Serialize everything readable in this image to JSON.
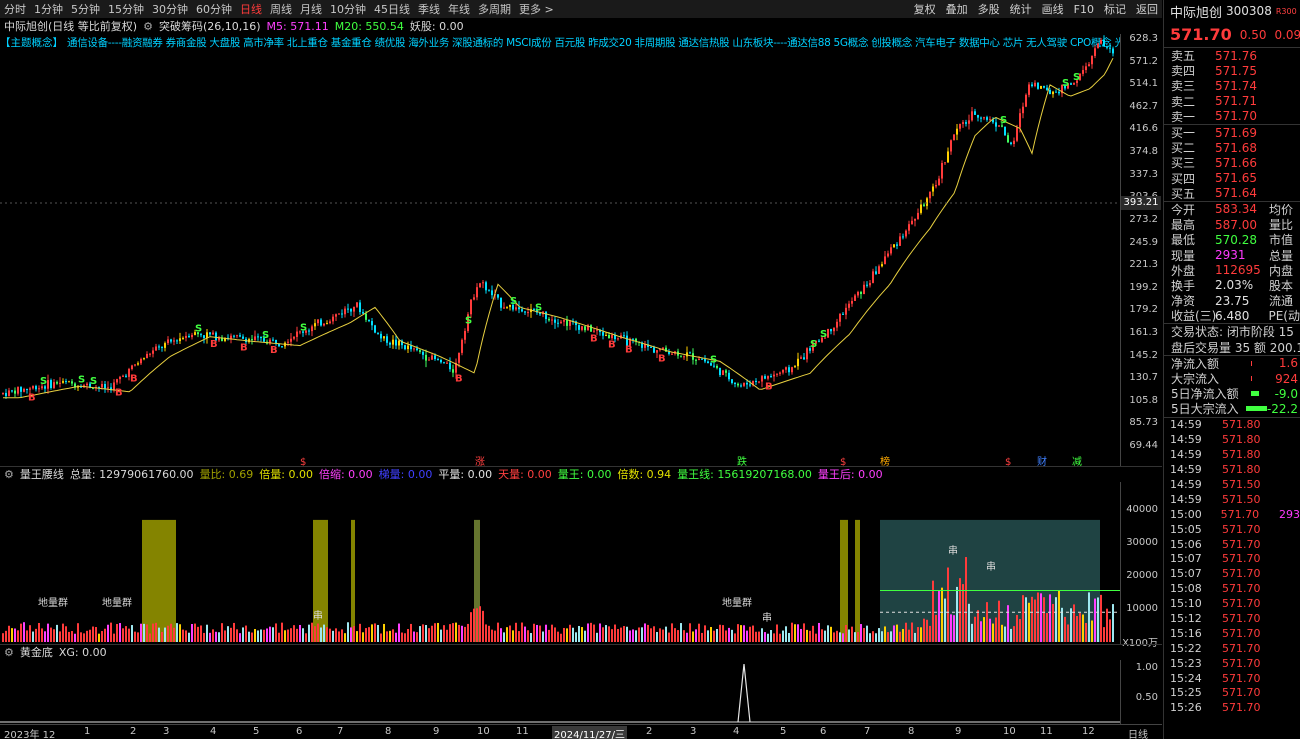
{
  "toolbar": {
    "periods": [
      "分时",
      "1分钟",
      "5分钟",
      "15分钟",
      "30分钟",
      "60分钟",
      "日线",
      "周线",
      "月线",
      "10分钟",
      "45日线",
      "季线",
      "年线",
      "多周期",
      "更多 >"
    ],
    "active_period": "日线",
    "tools": [
      "复权",
      "叠加",
      "多股",
      "统计",
      "画线",
      "F10",
      "标记",
      "返回"
    ]
  },
  "info": {
    "stock_label": "中际旭创(日线 等比前复权)",
    "indicator": "突破筹码(26,10,16)",
    "ma5": "M5: 571.11",
    "ma20": "M20: 550.54",
    "yao": "妖股: 0.00"
  },
  "concepts": {
    "label": "【主题概念】",
    "items": "通信设备----融资融券 券商金股 大盘股 高市净率 北上重仓 基金重仓 绩优股 海外业务 深股通标的 MSCI成份 百元股 昨成交20 非周期股 通达信热股 山东板块----通达信88 5G概念 创投概念 汽车电子 数据中心 芯片 无人驾驶 CPO概念 光"
  },
  "main_axis": [
    "628.3",
    "571.2",
    "514.1",
    "462.7",
    "416.6",
    "374.8",
    "337.3",
    "303.6",
    "273.2",
    "245.9",
    "221.3",
    "199.2",
    "179.2",
    "161.3",
    "145.2",
    "130.7",
    "105.8",
    "85.73",
    "69.44"
  ],
  "current_price_box": "393.21",
  "markers": [
    {
      "t": "$",
      "c": "#ff4040"
    },
    {
      "t": "涨",
      "c": "#ff4040"
    },
    {
      "t": "跌",
      "c": "#40ff40"
    },
    {
      "t": "$",
      "c": "#ff4040"
    },
    {
      "t": "榜",
      "c": "#ffaa00"
    },
    {
      "t": "$",
      "c": "#ff4040"
    },
    {
      "t": "财",
      "c": "#4080ff"
    },
    {
      "t": "减",
      "c": "#40ff40"
    }
  ],
  "vol_panel": {
    "title": "量王腰线",
    "total": "总量: 12979061760.00",
    "fields": [
      {
        "t": "量比: 0.69",
        "c": "#a0a000"
      },
      {
        "t": "倍量: 0.00",
        "c": "#e0e000"
      },
      {
        "t": "倍缩: 0.00",
        "c": "#ff40ff"
      },
      {
        "t": "梯量: 0.00",
        "c": "#4040ff"
      },
      {
        "t": "平量: 0.00",
        "c": "#e0e0e0"
      },
      {
        "t": "天量: 0.00",
        "c": "#ff4040"
      },
      {
        "t": "量王: 0.00",
        "c": "#40ff40"
      },
      {
        "t": "倍数: 0.94",
        "c": "#e0e000"
      },
      {
        "t": "量王线: 15619207168.00",
        "c": "#40ff40"
      },
      {
        "t": "量王后: 0.00",
        "c": "#ff40ff"
      }
    ],
    "axis": [
      "40000",
      "30000",
      "20000",
      "10000"
    ],
    "unit": "X100万",
    "labels": [
      "地量群",
      "地量群",
      "地量群",
      "串",
      "串",
      "串",
      "串"
    ]
  },
  "gold_panel": {
    "title": "黄金底",
    "xg": "XG: 0.00",
    "axis": [
      "1.00",
      "0.50"
    ]
  },
  "xaxis": {
    "labels": [
      "2023年 12",
      "1",
      "2",
      "3",
      "4",
      "5",
      "6",
      "7",
      "8",
      "9",
      "10",
      "11",
      "2024/11/27/三",
      "2",
      "3",
      "4",
      "5",
      "6",
      "7",
      "8",
      "9",
      "10",
      "11",
      "12"
    ],
    "period": "日线"
  },
  "quote": {
    "name": "中际旭创",
    "code": "300308",
    "tag": "R300",
    "last": "571.70",
    "change": "0.50",
    "change_pct": "0.09%",
    "asks": [
      {
        "l": "卖五",
        "p": "571.76"
      },
      {
        "l": "卖四",
        "p": "571.75"
      },
      {
        "l": "卖三",
        "p": "571.74"
      },
      {
        "l": "卖二",
        "p": "571.71"
      },
      {
        "l": "卖一",
        "p": "571.70"
      }
    ],
    "bids": [
      {
        "l": "买一",
        "p": "571.69"
      },
      {
        "l": "买二",
        "p": "571.68"
      },
      {
        "l": "买三",
        "p": "571.66"
      },
      {
        "l": "买四",
        "p": "571.65"
      },
      {
        "l": "买五",
        "p": "571.64"
      }
    ],
    "stats": [
      {
        "l": "今开",
        "v": "583.34",
        "vc": "#ff3b3b",
        "r": "均价"
      },
      {
        "l": "最高",
        "v": "587.00",
        "vc": "#ff3b3b",
        "r": "量比"
      },
      {
        "l": "最低",
        "v": "570.28",
        "vc": "#40ff40",
        "r": "市值"
      },
      {
        "l": "现量",
        "v": "2931",
        "vc": "#ff3bff",
        "r": "总量"
      },
      {
        "l": "外盘",
        "v": "112695",
        "vc": "#ff3b3b",
        "r": "内盘"
      },
      {
        "l": "换手",
        "v": "2.03%",
        "vc": "#e0e0e0",
        "r": "股本"
      },
      {
        "l": "净资",
        "v": "23.75",
        "vc": "#e0e0e0",
        "r": "流通"
      },
      {
        "l": "收益(三)",
        "v": "6.480",
        "vc": "#e0e0e0",
        "r": "PE(动"
      }
    ],
    "trade_status": "交易状态: 闭市阶段 15",
    "after_hours": "盘后交易量 35 额 200.1",
    "flows": [
      {
        "l": "净流入额",
        "v": "1.6",
        "c": "#ff3b3b"
      },
      {
        "l": "大宗流入",
        "v": "924",
        "c": "#ff3b3b"
      },
      {
        "l": "5日净流入额",
        "v": "-9.0",
        "c": "#40ff40"
      },
      {
        "l": "5日大宗流入",
        "v": "-22.2",
        "c": "#40ff40"
      }
    ],
    "ticks": [
      {
        "t": "14:59",
        "p": "571.80",
        "v": ""
      },
      {
        "t": "14:59",
        "p": "571.80",
        "v": ""
      },
      {
        "t": "14:59",
        "p": "571.80",
        "v": ""
      },
      {
        "t": "14:59",
        "p": "571.80",
        "v": ""
      },
      {
        "t": "14:59",
        "p": "571.50",
        "v": ""
      },
      {
        "t": "14:59",
        "p": "571.50",
        "v": ""
      },
      {
        "t": "15:00",
        "p": "571.70",
        "v": "293"
      },
      {
        "t": "15:05",
        "p": "571.70",
        "v": ""
      },
      {
        "t": "15:06",
        "p": "571.70",
        "v": ""
      },
      {
        "t": "15:07",
        "p": "571.70",
        "v": ""
      },
      {
        "t": "15:07",
        "p": "571.70",
        "v": ""
      },
      {
        "t": "15:08",
        "p": "571.70",
        "v": ""
      },
      {
        "t": "15:10",
        "p": "571.70",
        "v": ""
      },
      {
        "t": "15:12",
        "p": "571.70",
        "v": ""
      },
      {
        "t": "15:16",
        "p": "571.70",
        "v": ""
      },
      {
        "t": "15:22",
        "p": "571.70",
        "v": ""
      },
      {
        "t": "15:23",
        "p": "571.70",
        "v": ""
      },
      {
        "t": "15:24",
        "p": "571.70",
        "v": ""
      },
      {
        "t": "15:25",
        "p": "571.70",
        "v": ""
      },
      {
        "t": "15:26",
        "p": "571.70",
        "v": ""
      }
    ]
  },
  "colors": {
    "up": "#ff3b3b",
    "down": "#00e0ff",
    "ma": "#e8d040",
    "accent": "#ff3b3b"
  }
}
